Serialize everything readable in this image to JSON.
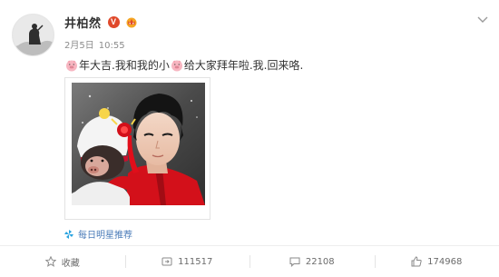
{
  "user": {
    "name": "井柏然",
    "verified_badge": "V",
    "accent_color": "#e0492b"
  },
  "meta": {
    "date": "2月5日",
    "time": "10:55"
  },
  "post": {
    "segments": [
      {
        "type": "icon",
        "icon": "pig-emoji"
      },
      {
        "type": "text",
        "text": "年大吉.我和我的小"
      },
      {
        "type": "icon",
        "icon": "pig-emoji"
      },
      {
        "type": "text",
        "text": "给大家拜年啦.我.回来咯."
      }
    ]
  },
  "recommend": {
    "icon": "pinwheel-icon",
    "label": "每日明星推荐"
  },
  "actions": {
    "collect": {
      "icon": "star-icon",
      "label": "收藏"
    },
    "repost": {
      "icon": "repost-icon",
      "count": "111517"
    },
    "comment": {
      "icon": "comment-icon",
      "count": "22108"
    },
    "like": {
      "icon": "thumbs-up-icon",
      "count": "174968"
    }
  }
}
